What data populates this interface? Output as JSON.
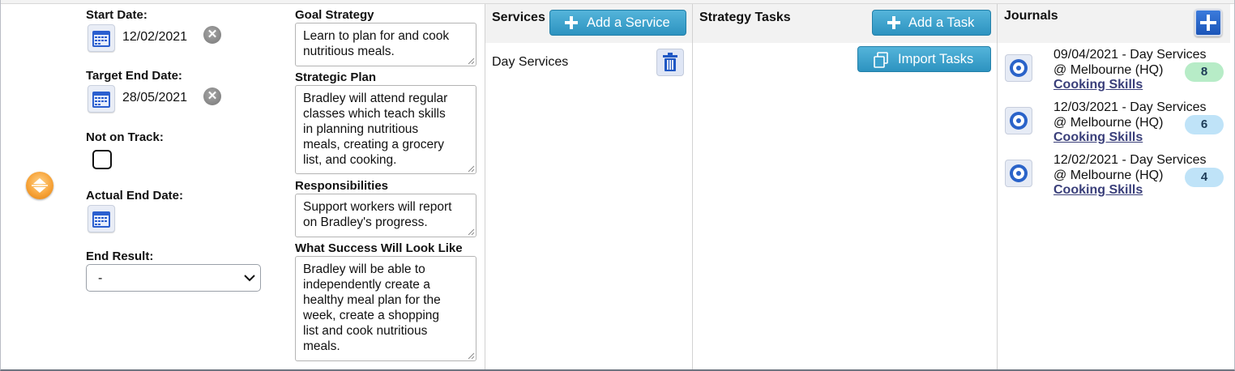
{
  "colors": {
    "accent_button": "#3aa3cf",
    "badge_green": "#b7ecc7",
    "badge_blue": "#bfe3f8",
    "link": "#3a3f7a"
  },
  "dates": {
    "start_label": "Start Date:",
    "start_value": "12/02/2021",
    "target_label": "Target End Date:",
    "target_value": "28/05/2021",
    "not_on_track_label": "Not on Track:",
    "actual_end_label": "Actual End Date:",
    "end_result_label": "End Result:",
    "end_result_value": "-"
  },
  "goal": {
    "strategy_label": "Goal Strategy",
    "strategy_text": "Learn to plan for and cook\nnutritious meals.",
    "plan_label": "Strategic Plan",
    "plan_text": "Bradley will attend regular\nclasses which teach skills\nin planning nutritious\nmeals, creating a grocery\nlist, and cooking.",
    "resp_label": "Responsibilities",
    "resp_text": "Support workers will report\non Bradley's progress.",
    "success_label": "What Success Will Look Like",
    "success_text": "Bradley will be able to\nindependently create a\nhealthy meal plan for the\nweek, create a shopping\nlist and cook nutritious\nmeals."
  },
  "services": {
    "title": "Services",
    "add_label": "Add a Service",
    "items": [
      {
        "name": "Day Services"
      }
    ]
  },
  "tasks": {
    "title": "Strategy Tasks",
    "add_label": "Add a Task",
    "import_label": "Import Tasks"
  },
  "journals": {
    "title": "Journals",
    "entries": [
      {
        "date_line": "09/04/2021  -  Day Services",
        "location": "@ Melbourne (HQ)",
        "link": "Cooking Skills",
        "count": "8",
        "badge_color": "green"
      },
      {
        "date_line": "12/03/2021  -  Day Services",
        "location": "@ Melbourne (HQ)",
        "link": "Cooking Skills",
        "count": "6",
        "badge_color": "blue"
      },
      {
        "date_line": "12/02/2021  -  Day Services",
        "location": "@ Melbourne (HQ)",
        "link": "Cooking Skills",
        "count": "4",
        "badge_color": "blue"
      }
    ]
  }
}
